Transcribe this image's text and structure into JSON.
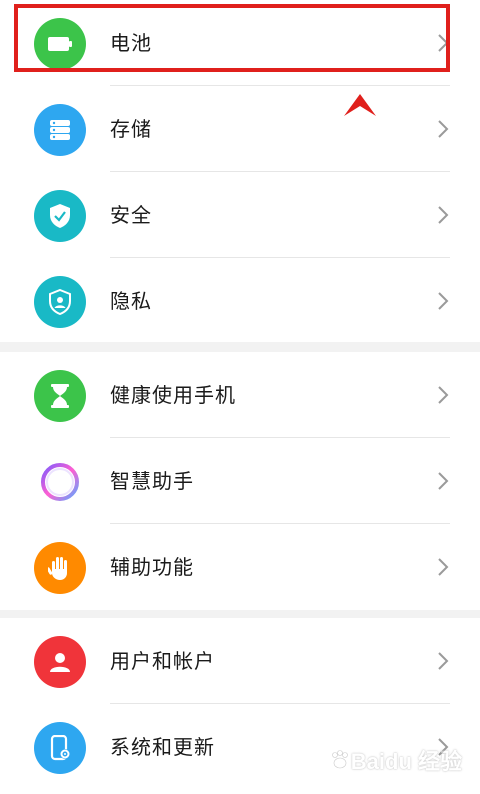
{
  "groups": [
    {
      "items": [
        {
          "label": "电池",
          "icon": "battery-icon",
          "color": "#3cc44a"
        },
        {
          "label": "存储",
          "icon": "storage-icon",
          "color": "#2ea7f0"
        },
        {
          "label": "安全",
          "icon": "shield-check-icon",
          "color": "#19b9c6"
        },
        {
          "label": "隐私",
          "icon": "privacy-shield-icon",
          "color": "#19b9c6"
        }
      ]
    },
    {
      "items": [
        {
          "label": "健康使用手机",
          "icon": "hourglass-icon",
          "color": "#3cc44a"
        },
        {
          "label": "智慧助手",
          "icon": "assistant-ring-icon",
          "color": "#ffffff"
        },
        {
          "label": "辅助功能",
          "icon": "hand-icon",
          "color": "#ff8a00"
        }
      ]
    },
    {
      "items": [
        {
          "label": "用户和帐户",
          "icon": "user-icon",
          "color": "#f0343a"
        },
        {
          "label": "系统和更新",
          "icon": "phone-settings-icon",
          "color": "#2ea7f0"
        }
      ]
    }
  ],
  "annotation": {
    "highlight_color": "#e0201c"
  },
  "watermark": {
    "text": "Baidu 经验"
  }
}
